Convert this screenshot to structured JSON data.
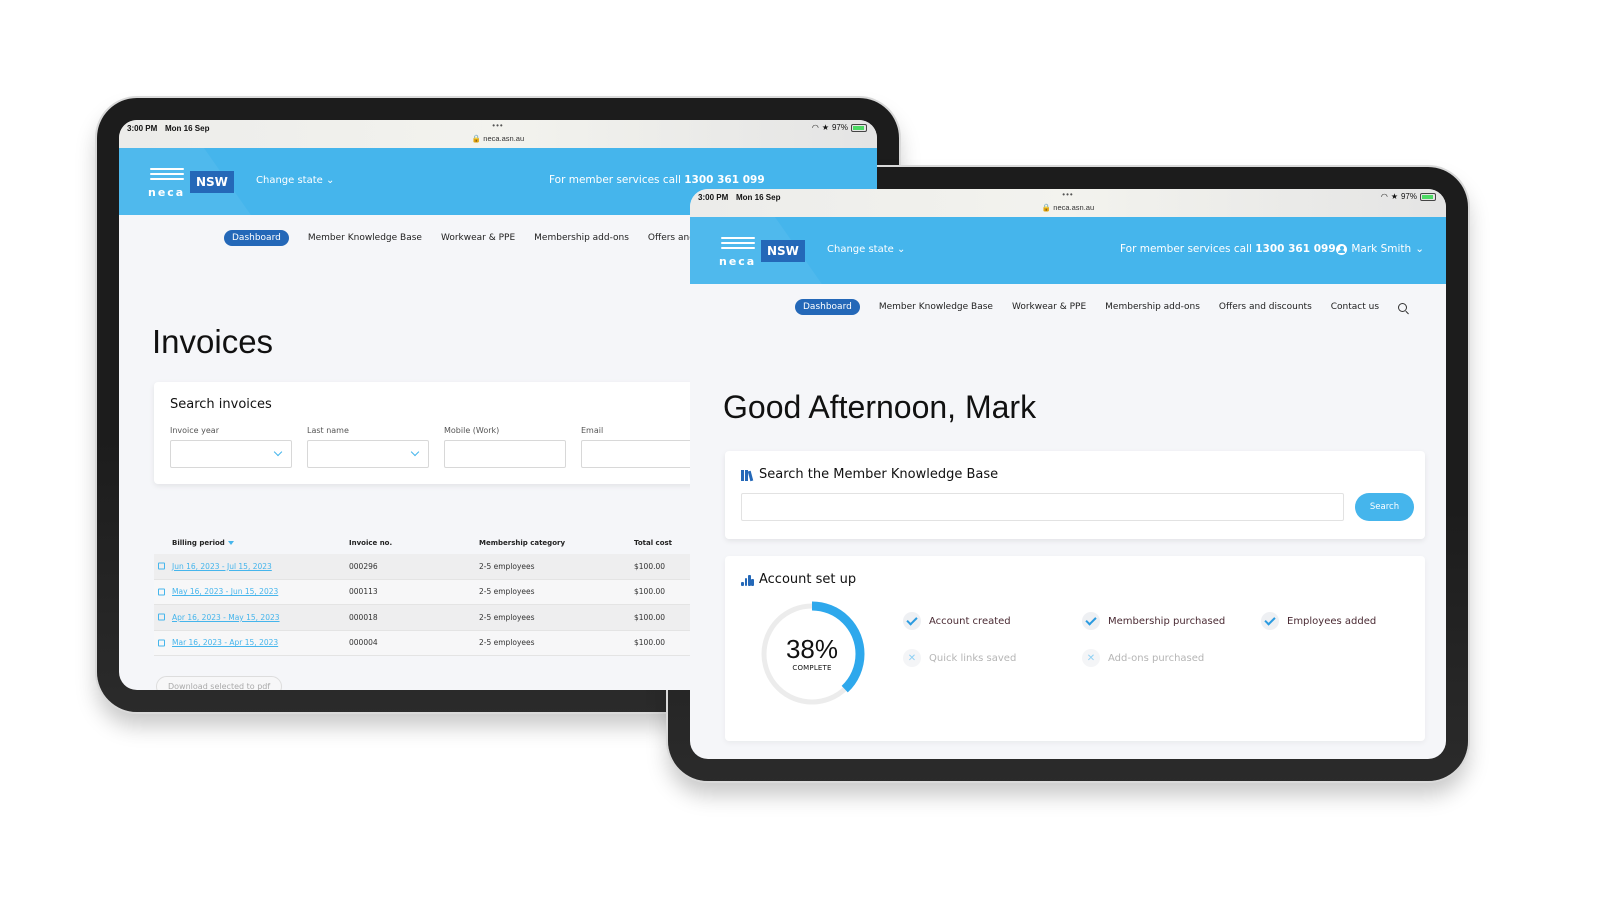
{
  "status_bar": {
    "time": "3:00 PM",
    "date": "Mon 16 Sep",
    "dots": "•••",
    "url": "🔒 neca.asn.au",
    "battery": "97%",
    "wifi_icon": "wifi-icon",
    "bluetooth_icon": "star-icon"
  },
  "brand": {
    "logo_text": "neca",
    "state_badge": "NSW",
    "change_state": "Change state",
    "accent": "#45b5ec",
    "dark_accent": "#2468b8"
  },
  "header": {
    "member_services_prefix": "For member services call",
    "member_services_phone": "1300 361 099",
    "user_name": "Mark Smith"
  },
  "nav": {
    "items": [
      {
        "label": "Dashboard",
        "active": true
      },
      {
        "label": "Member Knowledge Base"
      },
      {
        "label": "Workwear & PPE"
      },
      {
        "label": "Membership add-ons"
      },
      {
        "label": "Offers and discounts"
      },
      {
        "label": "Contact us"
      }
    ],
    "search_icon": "search-icon"
  },
  "invoices_page": {
    "title": "Invoices",
    "search_card": {
      "title": "Search invoices",
      "fields": [
        {
          "label": "Invoice year",
          "type": "select",
          "value": ""
        },
        {
          "label": "Last name",
          "type": "select",
          "value": ""
        },
        {
          "label": "Mobile (Work)",
          "type": "text",
          "value": ""
        },
        {
          "label": "Email",
          "type": "text",
          "value": ""
        }
      ]
    },
    "table": {
      "columns": [
        "Billing period",
        "Invoice no.",
        "Membership category",
        "Total cost"
      ],
      "rows": [
        {
          "period": "Jun 16, 2023 - Jul 15, 2023",
          "invoice": "000296",
          "category": "2-5 employees",
          "total": "$100.00"
        },
        {
          "period": "May 16, 2023 - Jun 15, 2023",
          "invoice": "000113",
          "category": "2-5 employees",
          "total": "$100.00"
        },
        {
          "period": "Apr 16, 2023 - May 15, 2023",
          "invoice": "000018",
          "category": "2-5 employees",
          "total": "$100.00"
        },
        {
          "period": "Mar 16, 2023 - Apr 15, 2023",
          "invoice": "000004",
          "category": "2-5 employees",
          "total": "$100.00"
        }
      ]
    },
    "download_button": "Download selected to pdf"
  },
  "dashboard_page": {
    "greeting": "Good Afternoon, Mark",
    "knowledge_search": {
      "title": "Search the Member Knowledge Base",
      "input_value": "",
      "input_placeholder": "",
      "button": "Search"
    },
    "account_setup": {
      "title": "Account set up",
      "percent": 38,
      "percent_label": "38%",
      "complete_label": "COMPLETE",
      "steps": [
        {
          "label": "Account created",
          "done": true
        },
        {
          "label": "Membership purchased",
          "done": true
        },
        {
          "label": "Employees added",
          "done": true
        },
        {
          "label": "Quick links saved",
          "done": false
        },
        {
          "label": "Add-ons purchased",
          "done": false
        }
      ]
    }
  }
}
